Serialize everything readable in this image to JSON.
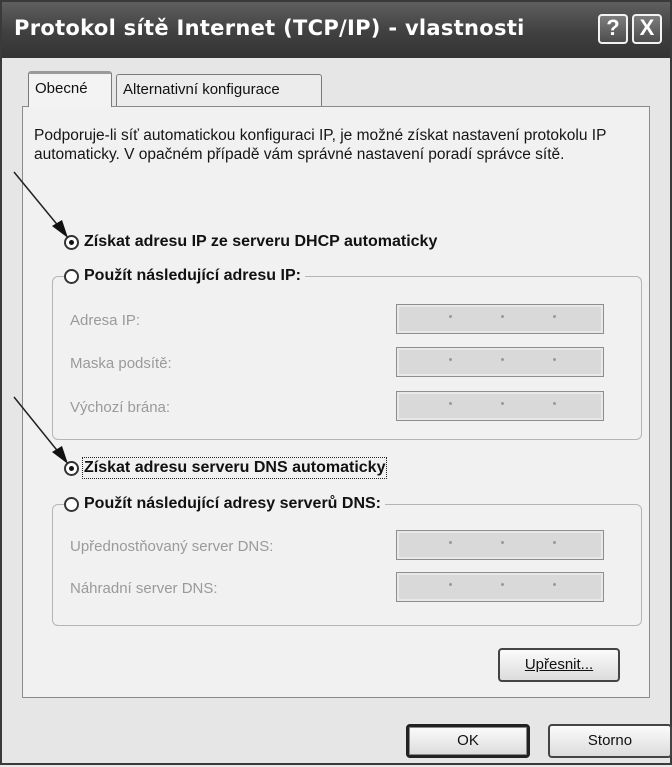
{
  "window": {
    "title": "Protokol sítě Internet (TCP/IP) - vlastnosti",
    "help_label": "?",
    "close_label": "X"
  },
  "tabs": [
    {
      "label": "Obecné",
      "active": true
    },
    {
      "label": "Alternativní konfigurace",
      "active": false
    }
  ],
  "description": "Podporuje-li síť automatickou konfiguraci IP, je možné získat nastavení protokolu IP automaticky. V opačném případě vám správné nastavení poradí správce sítě.",
  "ip_section": {
    "auto_option": {
      "label": "Získat adresu IP ze serveru DHCP automaticky",
      "selected": true
    },
    "manual_option": {
      "label": "Použít následující adresu IP:",
      "selected": false
    },
    "fields": [
      {
        "label": "Adresa IP:",
        "value": ". . ."
      },
      {
        "label": "Maska podsítě:",
        "value": ". . ."
      },
      {
        "label": "Výchozí brána:",
        "value": ". . ."
      }
    ]
  },
  "dns_section": {
    "auto_option": {
      "label": "Získat adresu serveru DNS automaticky",
      "selected": true
    },
    "manual_option": {
      "label": "Použít následující adresy serverů DNS:",
      "selected": false
    },
    "fields": [
      {
        "label": "Upřednostňovaný server DNS:",
        "value": ". . ."
      },
      {
        "label": "Náhradní server DNS:",
        "value": ". . ."
      }
    ]
  },
  "buttons": {
    "advanced": "Upřesnit...",
    "ok": "OK",
    "cancel": "Storno"
  }
}
